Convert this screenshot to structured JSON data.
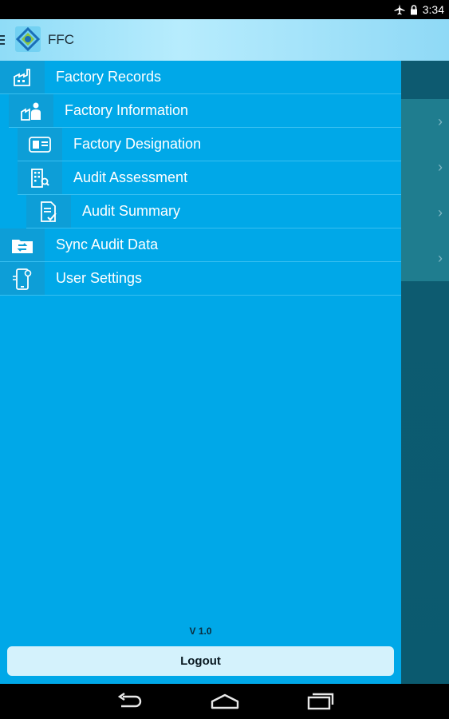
{
  "status_bar": {
    "time": "3:34",
    "icons": [
      "airplane-icon",
      "lock-icon"
    ]
  },
  "app_bar": {
    "title": "FFC",
    "logo": "ffc-logo-icon"
  },
  "menu": {
    "items": [
      {
        "label": "Factory Records",
        "icon": "factory-icon"
      },
      {
        "label": "Factory Information",
        "icon": "factory-person-icon"
      },
      {
        "label": "Factory Designation",
        "icon": "id-card-icon"
      },
      {
        "label": "Audit Assessment",
        "icon": "building-search-icon"
      },
      {
        "label": "Audit Summary",
        "icon": "document-check-icon"
      },
      {
        "label": "Sync Audit Data",
        "icon": "sync-folder-icon"
      },
      {
        "label": "User Settings",
        "icon": "phone-settings-icon"
      }
    ]
  },
  "footer": {
    "version": "V 1.0",
    "logout_label": "Logout"
  },
  "nav_bar": {
    "icons": [
      "back-icon",
      "home-icon",
      "recents-icon"
    ]
  },
  "colors": {
    "drawer": "#00a8e8",
    "icon_cell": "#0d9ed7",
    "app_bar": "#a6e4fa",
    "content_bg": "#0d5a70"
  }
}
